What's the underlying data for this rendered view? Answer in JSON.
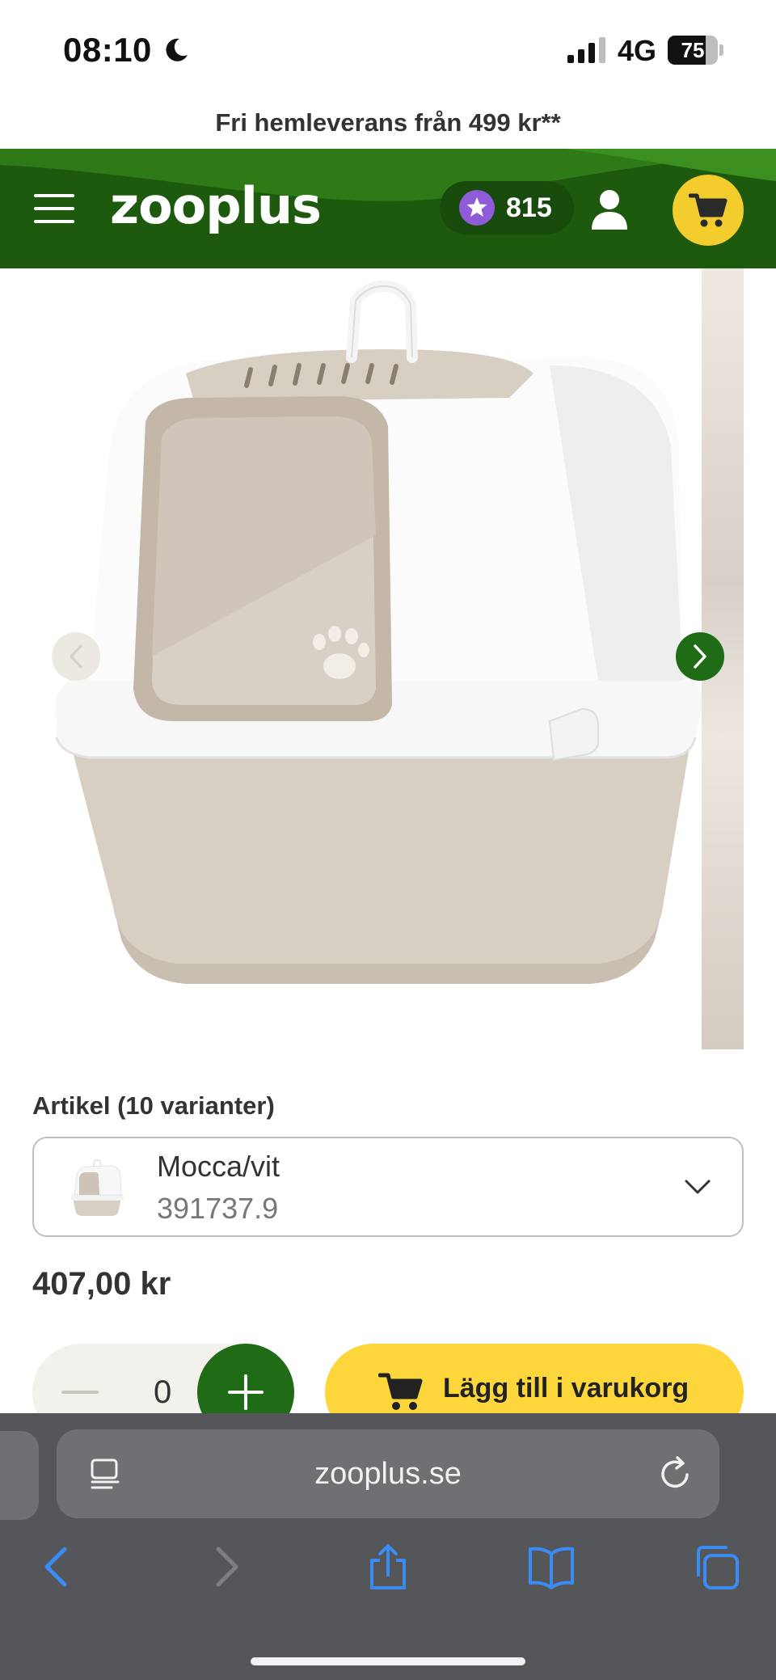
{
  "status_bar": {
    "time": "08:10",
    "network": "4G",
    "battery_percent": "75",
    "battery_level": 0.75
  },
  "promo": {
    "text": "Fri hemleverans från 499 kr**"
  },
  "header": {
    "logo": "zooplus",
    "points": "815",
    "colors": {
      "bar": "#1f5c0f",
      "cart_button": "#f3cd2e",
      "points_badge": "#8f5bd9"
    }
  },
  "gallery": {
    "prev_icon": "chevron-left-icon",
    "next_icon": "chevron-right-icon"
  },
  "product": {
    "variant_label": "Artikel (10 varianter)",
    "variant_name": "Mocca/vit",
    "variant_sku": "391737.9",
    "price": "407,00 kr",
    "quantity": "0",
    "add_to_cart": "Lägg till i varukorg"
  },
  "browser": {
    "url": "zooplus.se",
    "icons": [
      "back-icon",
      "forward-icon",
      "share-icon",
      "bookmarks-icon",
      "tabs-icon"
    ]
  }
}
